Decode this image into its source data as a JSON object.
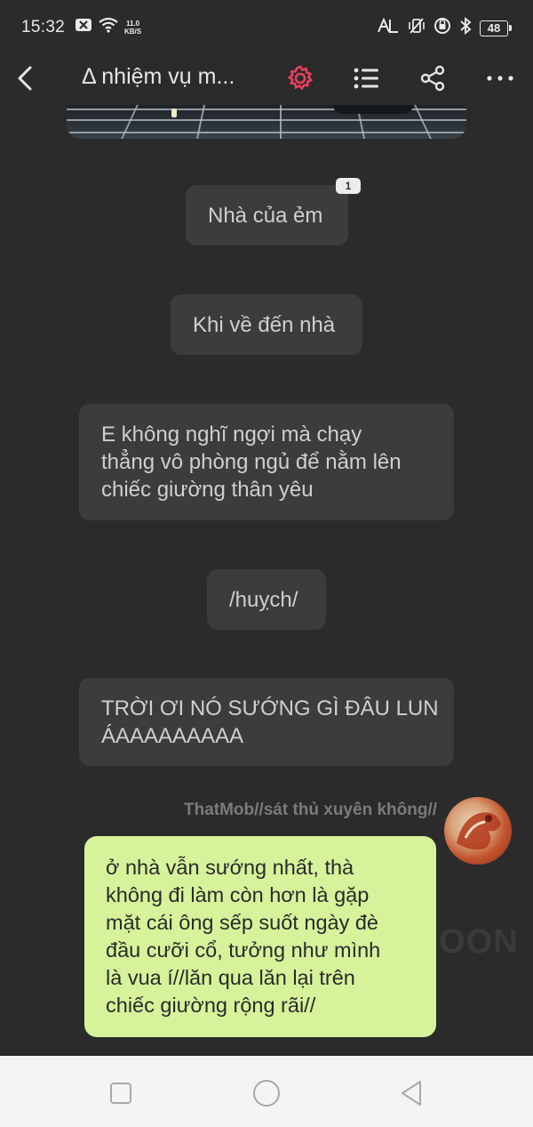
{
  "status_bar": {
    "time": "15:32",
    "speed_value": "11.0",
    "speed_unit": "KB/S",
    "battery": "48",
    "icons": [
      "close-box-icon",
      "wifi-icon",
      "hd-signal-icon",
      "vibrate-off-icon",
      "data-saver-icon",
      "bluetooth-icon",
      "battery-icon"
    ]
  },
  "toolbar": {
    "title": "Δ nhiệm vụ m...",
    "icons": [
      "back-icon",
      "settings-gear-icon",
      "list-icon",
      "share-icon",
      "more-icon"
    ],
    "accent_color": "#e8405e"
  },
  "messages": [
    {
      "text": "Nhà của ẻm",
      "badge": "1"
    },
    {
      "text": "Khi về đến nhà"
    },
    {
      "lines": [
        "E không nghĩ ngợi mà chạy",
        "thẳng vô phòng ngủ để nằm lên",
        "chiếc giường thân yêu"
      ]
    },
    {
      "text": "/huỵch/"
    },
    {
      "lines": [
        "TRỜI ƠI NÓ SƯỚNG GÌ ĐÂU LUN",
        "ÁAAAAAAAAA"
      ]
    }
  ],
  "reply": {
    "sender": "ThatMob//sát thủ xuyên không//",
    "lines": [
      "ở nhà vẫn sướng nhất, thà",
      "không đi làm còn hơn là gặp",
      "mặt cái ông sếp suốt ngày đè",
      "đầu cưỡi cổ, tưởng như mình",
      "là vua í//lăn qua lăn lại trên",
      "chiếc giường rộng rãi//"
    ],
    "bubble_color": "#d6f29b"
  },
  "watermark": "OON",
  "nav_bar": {
    "icons": [
      "recent-apps-icon",
      "home-icon",
      "back-triangle-icon"
    ]
  }
}
